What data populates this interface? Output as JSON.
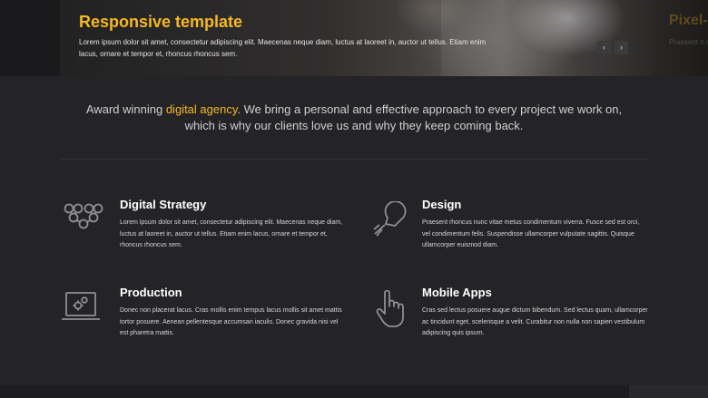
{
  "hero": {
    "title": "Responsive template",
    "text": "Lorem ipsum dolor sit amet, consectetur adipiscing elit. Maecenas neque diam, luctus at laoreet in, auctor ut tellus. Etiam enim lacus, ornare et tempor et, rhoncus rhoncus sem.",
    "prev_arrow": "‹",
    "next_arrow": "›",
    "next_slide_title": "Pixel-",
    "next_slide_text": "Praesent n ullamcorper"
  },
  "intro": {
    "before": "Award winning ",
    "highlight": "digital agency",
    "after": ". We bring a personal and effective approach to every project we work on,",
    "line2": "which is why our clients love us and why they keep coming back."
  },
  "services": [
    {
      "icon": "network-icon",
      "title": "Digital Strategy",
      "text": "Lorem ipsum dolor sit amet, consectetur adipiscing elit. Maecenas neque diam, luctus at laoreet in, auctor ut tellus. Etiam enim lacus, ornare et tempor et, rhoncus rhoncus sem."
    },
    {
      "icon": "lightbulb-icon",
      "title": "Design",
      "text": "Praesent rhoncus nunc vitae metus condimentum viverra. Fusce sed est orci, vel condimentum felis. Suspendisse ullamcorper vulputate sagittis. Quisque ullamcorper euismod diam."
    },
    {
      "icon": "laptop-gears-icon",
      "title": "Production",
      "text": "Donec non placerat lacus. Cras mollis enim tempus lacus mollis sit amet mattis tortor posuere. Aenean pellentesque accumsan iaculis. Donec gravida nisi vel est pharetra mattis."
    },
    {
      "icon": "hand-pointer-icon",
      "title": "Mobile Apps",
      "text": "Cras sed lectus posuere augue dictum bibendum. Sed lectus quam, ullamcorper ac tincidunt eget, scelerisque a velit. Curabitur non nulla non sapien vestibulum adipiscing quis ipsum."
    }
  ],
  "colors": {
    "accent": "#f5b921",
    "background": "#242427",
    "text": "#d6d6d6"
  }
}
